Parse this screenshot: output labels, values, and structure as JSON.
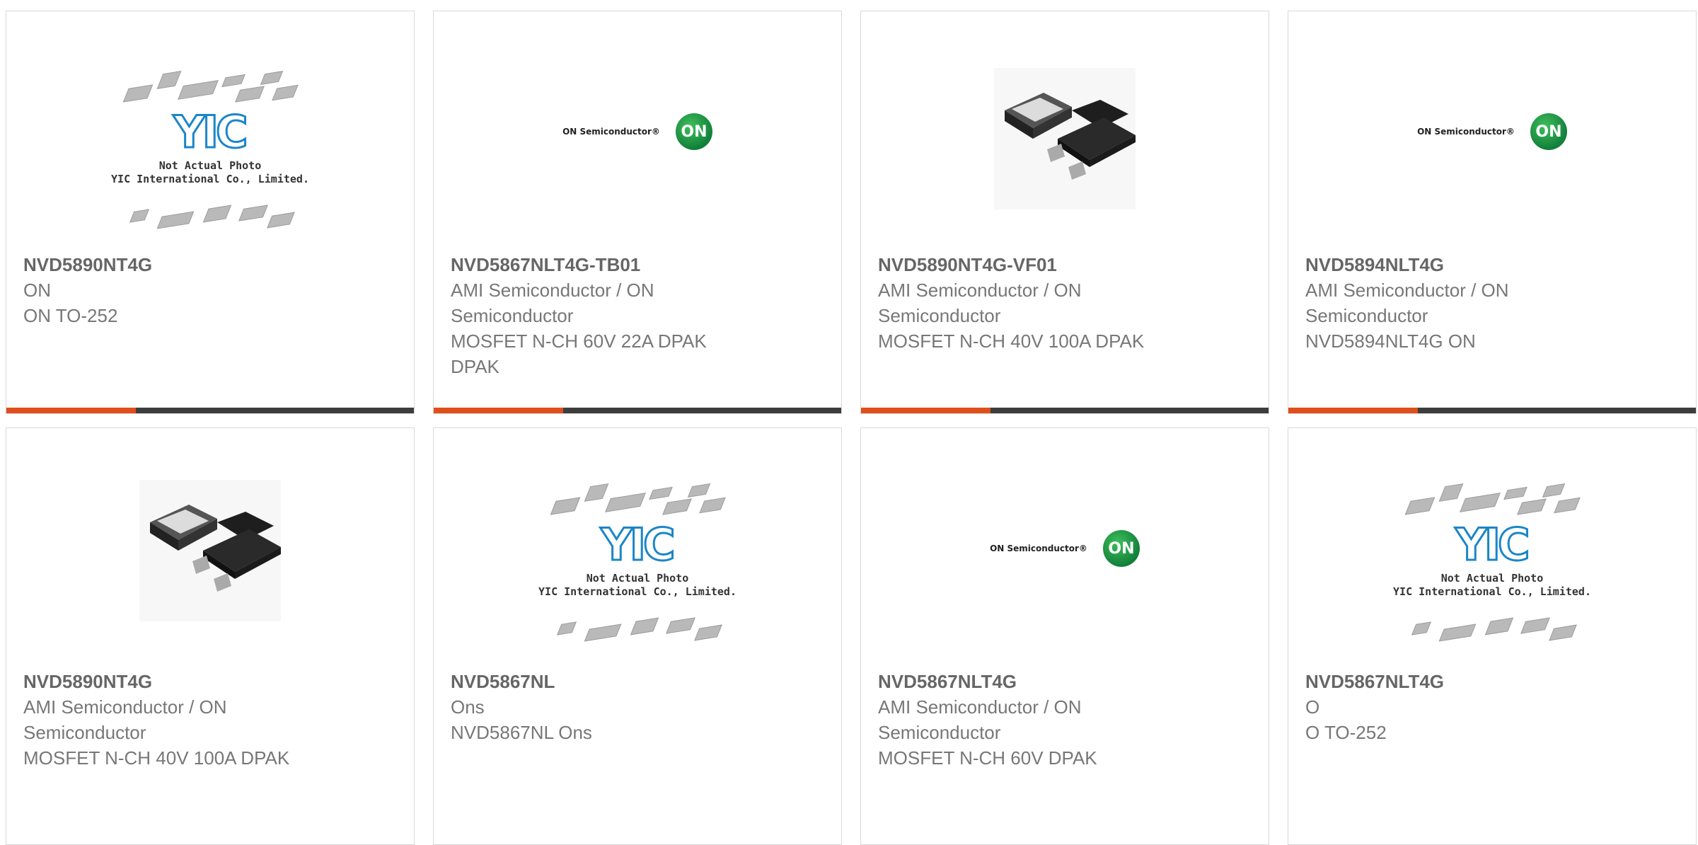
{
  "products": [
    {
      "part": "NVD5890NT4G",
      "maker": "ON",
      "desc": "ON TO-252",
      "image": "yic-placeholder"
    },
    {
      "part": "NVD5867NLT4G-TB01",
      "maker": "AMI Semiconductor / ON Semiconductor",
      "desc": "MOSFET N-CH 60V 22A DPAK DPAK",
      "image": "on-semiconductor-logo"
    },
    {
      "part": "NVD5890NT4G-VF01",
      "maker": "AMI Semiconductor / ON Semiconductor",
      "desc": "MOSFET N-CH 40V 100A DPAK",
      "image": "dpak-photo"
    },
    {
      "part": "NVD5894NLT4G",
      "maker": "AMI Semiconductor / ON Semiconductor",
      "desc": "NVD5894NLT4G ON",
      "image": "on-semiconductor-logo"
    },
    {
      "part": "NVD5890NT4G",
      "maker": "AMI Semiconductor / ON Semiconductor",
      "desc": "MOSFET N-CH 40V 100A DPAK",
      "image": "dpak-photo"
    },
    {
      "part": "NVD5867NL",
      "maker": "Ons",
      "desc": "NVD5867NL Ons",
      "image": "yic-placeholder"
    },
    {
      "part": "NVD5867NLT4G",
      "maker": "AMI Semiconductor / ON Semiconductor",
      "desc": "MOSFET N-CH 60V DPAK",
      "image": "on-semiconductor-logo"
    },
    {
      "part": "NVD5867NLT4G",
      "maker": "O",
      "desc": "O TO-252",
      "image": "yic-placeholder"
    }
  ],
  "yic": {
    "logo": "YIC",
    "caption_line1": "Not Actual Photo",
    "caption_line2": "YIC International Co., Limited."
  },
  "on_logo": {
    "wordmark": "ON Semiconductor®",
    "badge": "ON"
  },
  "colors": {
    "accent": "#e04e1b",
    "bar": "#3d3d3d",
    "text": "#666666"
  }
}
